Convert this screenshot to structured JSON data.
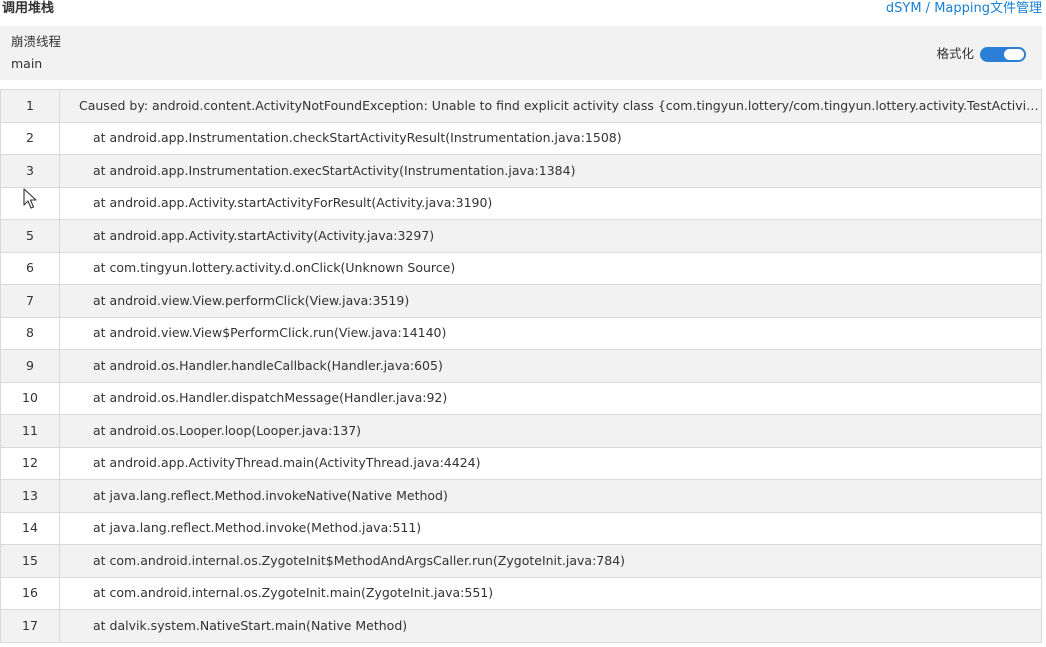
{
  "header": {
    "title": "调用堆栈",
    "mapping_link": "dSYM / Mapping文件管理"
  },
  "thread": {
    "label": "崩溃线程",
    "value": "main"
  },
  "format": {
    "label": "格式化",
    "enabled": true
  },
  "stack": {
    "frames": [
      {
        "num": "1",
        "text": "Caused by: android.content.ActivityNotFoundException: Unable to find explicit activity class {com.tingyun.lottery/com.tingyun.lottery.activity.TestActivity}; have you declared this activity in your AndroidManifest.xml?"
      },
      {
        "num": "2",
        "text": "at android.app.Instrumentation.checkStartActivityResult(Instrumentation.java:1508)"
      },
      {
        "num": "3",
        "text": "at android.app.Instrumentation.execStartActivity(Instrumentation.java:1384)"
      },
      {
        "num": "4",
        "text": "at android.app.Activity.startActivityForResult(Activity.java:3190)"
      },
      {
        "num": "5",
        "text": "at android.app.Activity.startActivity(Activity.java:3297)"
      },
      {
        "num": "6",
        "text": "at com.tingyun.lottery.activity.d.onClick(Unknown Source)"
      },
      {
        "num": "7",
        "text": "at android.view.View.performClick(View.java:3519)"
      },
      {
        "num": "8",
        "text": "at android.view.View$PerformClick.run(View.java:14140)"
      },
      {
        "num": "9",
        "text": "at android.os.Handler.handleCallback(Handler.java:605)"
      },
      {
        "num": "10",
        "text": "at android.os.Handler.dispatchMessage(Handler.java:92)"
      },
      {
        "num": "11",
        "text": "at android.os.Looper.loop(Looper.java:137)"
      },
      {
        "num": "12",
        "text": "at android.app.ActivityThread.main(ActivityThread.java:4424)"
      },
      {
        "num": "13",
        "text": "at java.lang.reflect.Method.invokeNative(Native Method)"
      },
      {
        "num": "14",
        "text": "at java.lang.reflect.Method.invoke(Method.java:511)"
      },
      {
        "num": "15",
        "text": "at com.android.internal.os.ZygoteInit$MethodAndArgsCaller.run(ZygoteInit.java:784)"
      },
      {
        "num": "16",
        "text": "at com.android.internal.os.ZygoteInit.main(ZygoteInit.java:551)"
      },
      {
        "num": "17",
        "text": "at dalvik.system.NativeStart.main(Native Method)"
      }
    ]
  },
  "colors": {
    "link": "#1a7fd4",
    "toggle_on": "#2b7fd6",
    "row_alt": "#f2f2f2",
    "border": "#d9d9d9"
  }
}
